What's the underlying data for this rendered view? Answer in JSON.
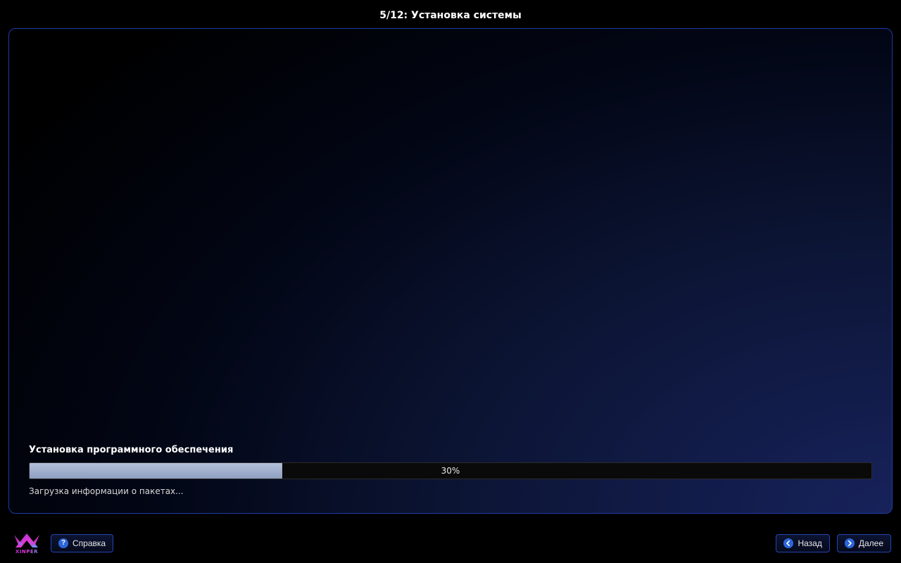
{
  "header": {
    "title": "5/12: Установка системы"
  },
  "progress": {
    "section_title": "Установка программного обеспечения",
    "percent": 30,
    "percent_label": "30%",
    "status_text": "Загрузка информации о пакетах..."
  },
  "footer": {
    "logo_text": "XINPER",
    "help_label": "Справка",
    "back_label": "Назад",
    "next_label": "Далее"
  },
  "colors": {
    "accent_border": "#1e3aa8",
    "button_icon_bg": "#2e66d9"
  }
}
